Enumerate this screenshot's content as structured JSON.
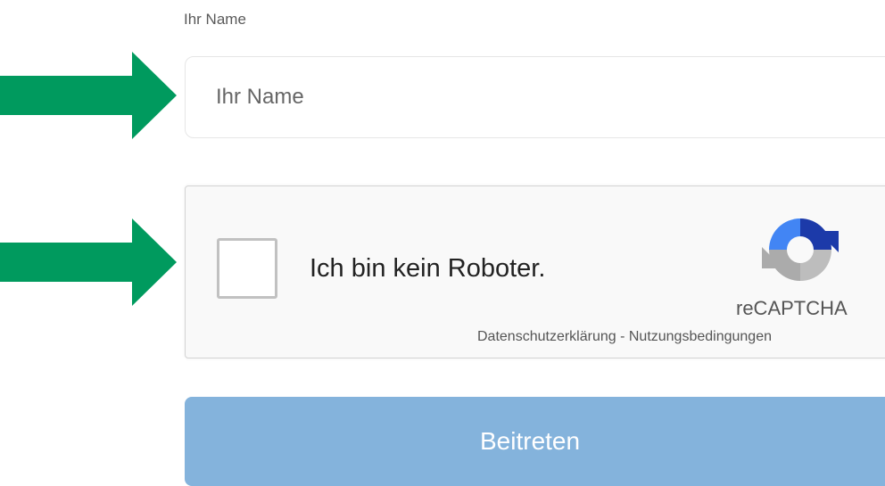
{
  "form": {
    "name_label": "Ihr Name",
    "name_placeholder": "Ihr Name",
    "submit_label": "Beitreten"
  },
  "captcha": {
    "text": "Ich bin kein Roboter.",
    "brand": "reCAPTCHA",
    "privacy_link": "Datenschutzerklärung",
    "separator": " - ",
    "terms_link": "Nutzungsbedingungen",
    "checked": false
  },
  "annotations": {
    "arrow_color": "#009A5E",
    "arrow_icon": "arrow-right-icon"
  },
  "colors": {
    "button_bg": "#84B3DC",
    "input_border": "#E6E6E6",
    "captcha_bg": "#F9F9F9"
  }
}
